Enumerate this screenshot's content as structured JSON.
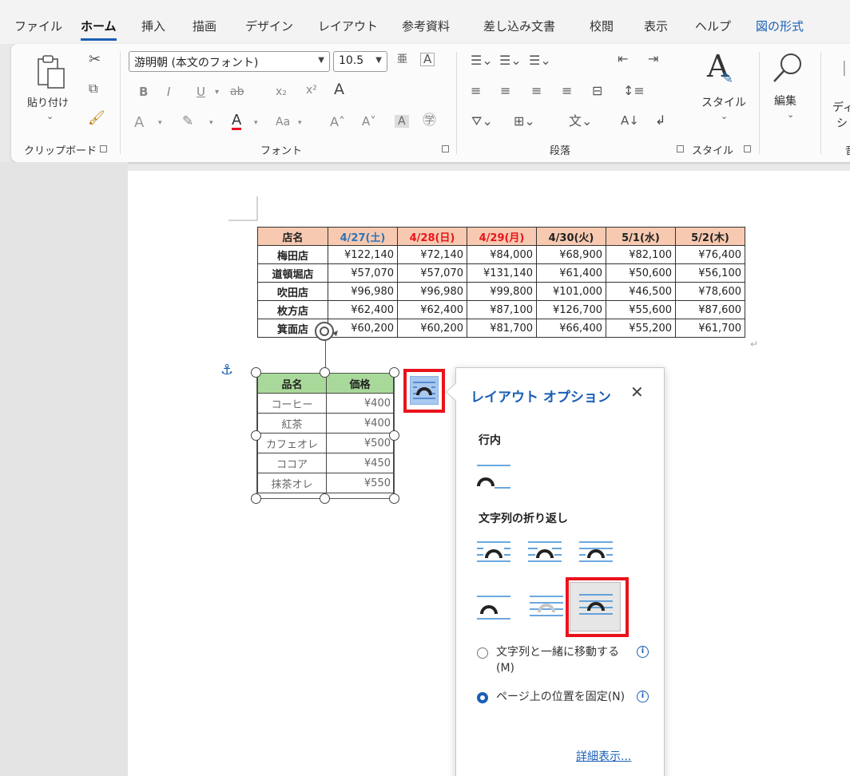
{
  "menubar": {
    "tabs": [
      "ファイル",
      "ホーム",
      "挿入",
      "描画",
      "デザイン",
      "レイアウト",
      "参考資料",
      "差し込み文書",
      "校閲",
      "表示",
      "ヘルプ",
      "図の形式"
    ],
    "active": "ホーム",
    "accent": "図の形式"
  },
  "ribbon": {
    "clipboard": {
      "paste_label": "貼り付け",
      "group_label": "クリップボード"
    },
    "font": {
      "font_name": "游明朝 (本文のフォント)",
      "font_size": "10.5",
      "group_label": "フォント"
    },
    "paragraph": {
      "group_label": "段落"
    },
    "styles": {
      "styles_label": "スタイル",
      "group_label": "スタイル"
    },
    "editing": {
      "label": "編集"
    },
    "dictation": {
      "label": "ディ",
      "label2": "シ",
      "group_label": "音"
    }
  },
  "sales_table": {
    "headers": [
      "店名",
      "4/27(土)",
      "4/28(日)",
      "4/29(月)",
      "4/30(火)",
      "5/1(水)",
      "5/2(木)"
    ],
    "header_colors": [
      "#222222",
      "#2e74b5",
      "#e8141c",
      "#e8141c",
      "#222222",
      "#222222",
      "#222222"
    ],
    "rows": [
      [
        "梅田店",
        "¥122,140",
        "¥72,140",
        "¥84,000",
        "¥68,900",
        "¥82,100",
        "¥76,400"
      ],
      [
        "道頓堀店",
        "¥57,070",
        "¥57,070",
        "¥131,140",
        "¥61,400",
        "¥50,600",
        "¥56,100"
      ],
      [
        "吹田店",
        "¥96,980",
        "¥96,980",
        "¥99,800",
        "¥101,000",
        "¥46,500",
        "¥78,600"
      ],
      [
        "枚方店",
        "¥62,400",
        "¥62,400",
        "¥87,100",
        "¥126,700",
        "¥55,600",
        "¥87,600"
      ],
      [
        "箕面店",
        "¥60,200",
        "¥60,200",
        "¥81,700",
        "¥66,400",
        "¥55,200",
        "¥61,700"
      ]
    ]
  },
  "menu_table": {
    "headers": [
      "品名",
      "価格"
    ],
    "rows": [
      [
        "コーヒー",
        "¥400"
      ],
      [
        "紅茶",
        "¥400"
      ],
      [
        "カフェオレ",
        "¥500"
      ],
      [
        "ココア",
        "¥450"
      ],
      [
        "抹茶オレ",
        "¥550"
      ]
    ]
  },
  "layout_popup": {
    "title": "レイアウト オプション",
    "close": "✕",
    "inline_section": "行内",
    "wrap_section": "文字列の折り返し",
    "option_move": "文字列と一緒に移動する(M)",
    "option_fixed": "ページ上の位置を固定(N)",
    "selected_option": "option_fixed",
    "more_link": "詳細表示..."
  },
  "colors": {
    "accent": "#1a5fb4",
    "highlight": "#e8141c",
    "sales_header_bg": "#f7c9b0",
    "menu_header_bg": "#a9d99a"
  }
}
